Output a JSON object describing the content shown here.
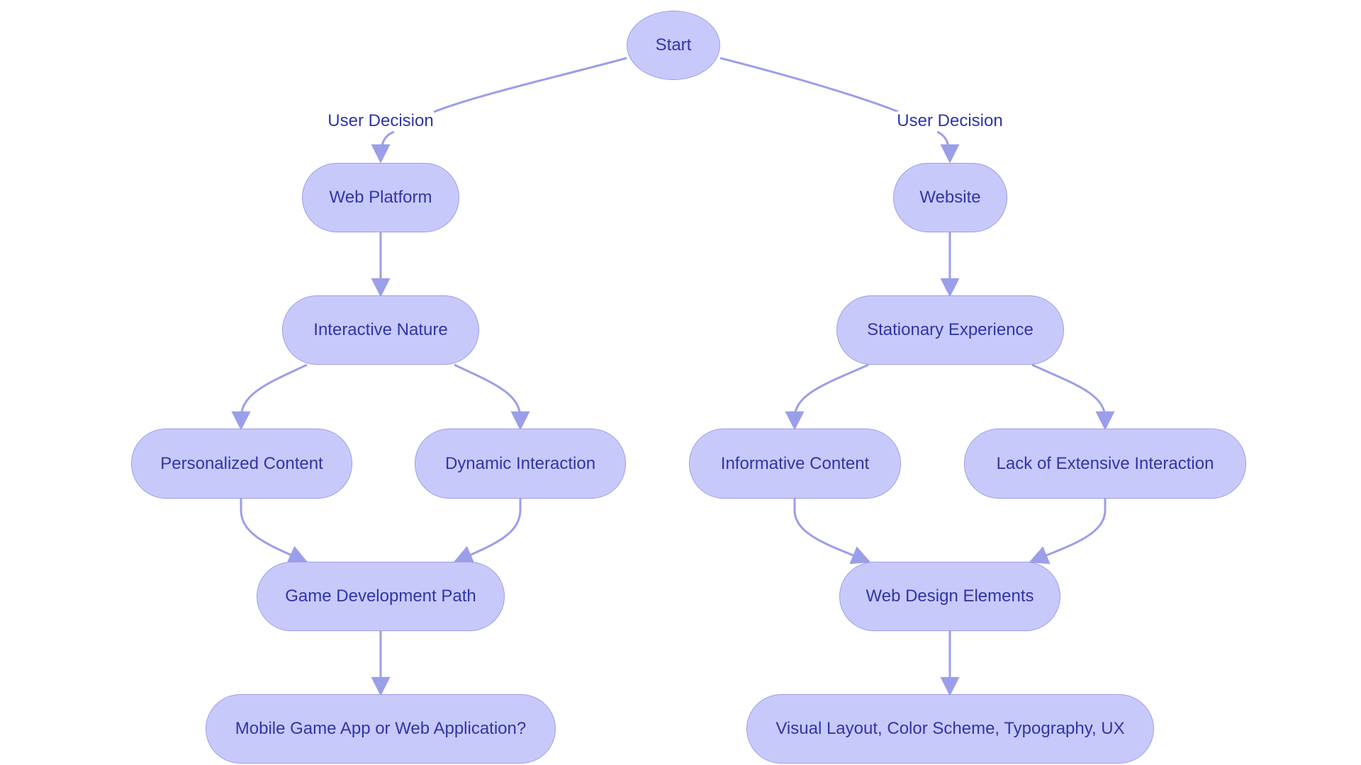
{
  "diagram": {
    "type": "flowchart",
    "colors": {
      "node_fill": "#c8c9fb",
      "node_stroke": "#9b9ee9",
      "text": "#2f35a8",
      "edge": "#9b9ee9"
    },
    "nodes": {
      "start": "Start",
      "web_platform": "Web Platform",
      "website": "Website",
      "interactive_nature": "Interactive Nature",
      "stationary_experience": "Stationary Experience",
      "personalized_content": "Personalized Content",
      "dynamic_interaction": "Dynamic Interaction",
      "informative_content": "Informative Content",
      "lack_interaction": "Lack of Extensive Interaction",
      "game_dev_path": "Game Development Path",
      "web_design_elements": "Web Design Elements",
      "mobile_or_web_app": "Mobile Game App or Web Application?",
      "visual_layout": "Visual Layout, Color Scheme, Typography, UX"
    },
    "edge_labels": {
      "left": "User Decision",
      "right": "User Decision"
    },
    "edges": [
      {
        "from": "start",
        "to": "web_platform",
        "label": "User Decision"
      },
      {
        "from": "start",
        "to": "website",
        "label": "User Decision"
      },
      {
        "from": "web_platform",
        "to": "interactive_nature"
      },
      {
        "from": "website",
        "to": "stationary_experience"
      },
      {
        "from": "interactive_nature",
        "to": "personalized_content"
      },
      {
        "from": "interactive_nature",
        "to": "dynamic_interaction"
      },
      {
        "from": "stationary_experience",
        "to": "informative_content"
      },
      {
        "from": "stationary_experience",
        "to": "lack_interaction"
      },
      {
        "from": "personalized_content",
        "to": "game_dev_path"
      },
      {
        "from": "dynamic_interaction",
        "to": "game_dev_path"
      },
      {
        "from": "informative_content",
        "to": "web_design_elements"
      },
      {
        "from": "lack_interaction",
        "to": "web_design_elements"
      },
      {
        "from": "game_dev_path",
        "to": "mobile_or_web_app"
      },
      {
        "from": "web_design_elements",
        "to": "visual_layout"
      }
    ]
  }
}
